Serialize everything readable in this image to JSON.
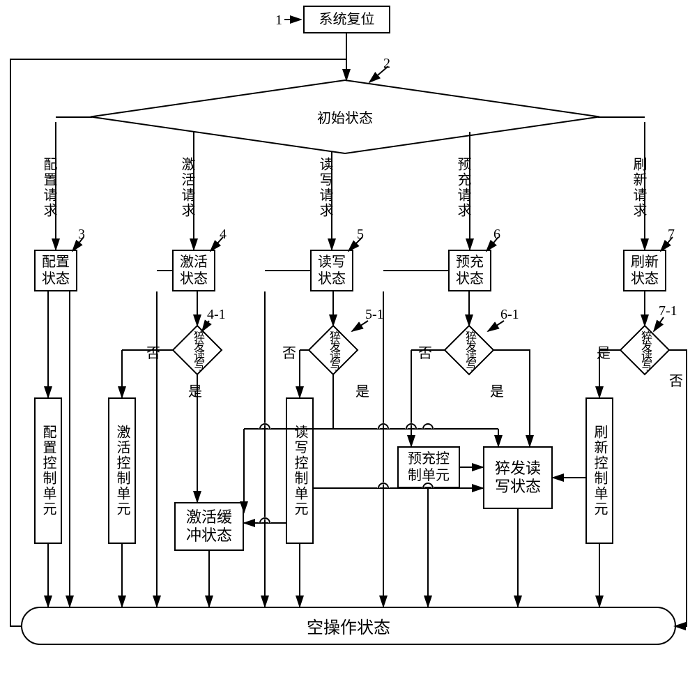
{
  "top": {
    "reset": "系统复位",
    "initial": "初始状态"
  },
  "requests": {
    "config": "配置请求",
    "activate": "激活请求",
    "rw": "读写请求",
    "precharge": "预充请求",
    "refresh": "刷新请求"
  },
  "states": {
    "config": "配置\n状态",
    "activate": "激活\n状态",
    "rw": "读写\n状态",
    "precharge": "预充\n状态",
    "refresh": "刷新\n状态"
  },
  "burst": "猝发读写",
  "yesno": {
    "yes": "是",
    "no": "否"
  },
  "units": {
    "config": "配置控制单元",
    "activate": "激活控制单元",
    "rw": "读写控制单元",
    "precharge": "预充控\n制单元",
    "refresh": "刷新控制单元",
    "burstState": "猝发读\n写状态",
    "actBuffer": "激活缓\n冲状态"
  },
  "idle": "空操作状态",
  "labels": {
    "n1": "1",
    "n2": "2",
    "n3": "3",
    "n4": "4",
    "n5": "5",
    "n6": "6",
    "n7": "7",
    "n41": "4-1",
    "n51": "5-1",
    "n61": "6-1",
    "n71": "7-1"
  }
}
